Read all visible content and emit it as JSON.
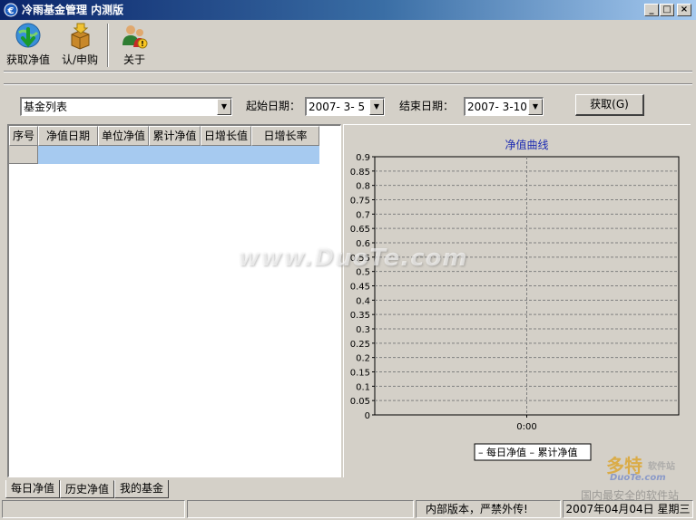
{
  "window": {
    "title": "冷雨基金管理  内测版",
    "minimize": "_",
    "maximize": "□",
    "close": "×"
  },
  "toolbar": {
    "get_nav": "获取净值",
    "subscribe": "认/申购",
    "about": "关于"
  },
  "filter": {
    "fund_list": "基金列表",
    "start_label": "起始日期：",
    "start_value": "2007-  3-  5",
    "end_label": "结束日期：",
    "end_value": "2007-  3-10",
    "fetch_button": "获取(G)"
  },
  "table": {
    "columns": [
      "序号",
      "净值日期",
      "单位净值",
      "累计净值",
      "日增长值",
      "日增长率"
    ]
  },
  "chart_data": {
    "type": "line",
    "title": "净值曲线",
    "x": [
      "0:00"
    ],
    "ylim": [
      0,
      0.9
    ],
    "yticks": [
      "0",
      "0.05",
      "0.1",
      "0.15",
      "0.2",
      "0.25",
      "0.3",
      "0.35",
      "0.4",
      "0.45",
      "0.5",
      "0.55",
      "0.6",
      "0.65",
      "0.7",
      "0.75",
      "0.8",
      "0.85",
      "0.9"
    ],
    "grid": true,
    "legend_position": "bottom",
    "series": [
      {
        "name": "每日净值",
        "values": []
      },
      {
        "name": "累计净值",
        "values": []
      }
    ],
    "legend_text": "– 每日净值 – 累计净值"
  },
  "tabs": [
    "每日净值",
    "历史净值",
    "我的基金"
  ],
  "status": {
    "message": "内部版本，严禁外传!",
    "datetime": "2007年04月04日  星期三"
  },
  "watermarks": {
    "center": "www.DuoTe.com",
    "corner_big": "多特",
    "corner_small": "软件站",
    "corner_site": "DuoTe.com",
    "corner_slogan": "国内最安全的软件站"
  },
  "colors": {
    "title_start": "#0a246a",
    "title_end": "#a6caf0",
    "chart_title": "#1c2bb2",
    "selected_row": "#a6caf0"
  }
}
